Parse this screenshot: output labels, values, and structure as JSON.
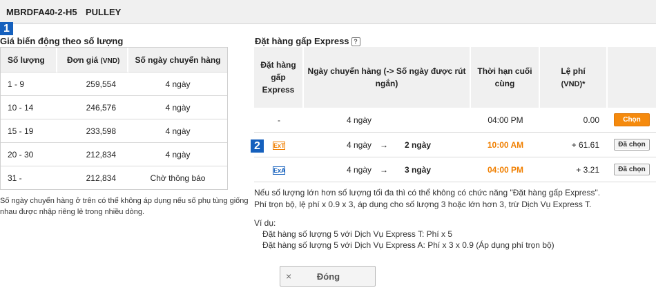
{
  "header": {
    "code": "MBRDFA40-2-H5",
    "name": "PULLEY"
  },
  "left": {
    "badge": "1",
    "title": "Giá biến động theo số lượng",
    "columns": {
      "qty": "Số lượng",
      "price": "Đơn giá",
      "price_unit": "(VND)",
      "days": "Số ngày chuyển hàng"
    },
    "rows": [
      {
        "qty": "1 - 9",
        "price": "259,554",
        "days": "4 ngày"
      },
      {
        "qty": "10 - 14",
        "price": "246,576",
        "days": "4 ngày"
      },
      {
        "qty": "15 - 19",
        "price": "233,598",
        "days": "4 ngày"
      },
      {
        "qty": "20 - 30",
        "price": "212,834",
        "days": "4 ngày"
      },
      {
        "qty": "31 -",
        "price": "212,834",
        "days": "Chờ thông báo"
      }
    ],
    "note": "Số ngày chuyển hàng ở trên có thể không áp dụng nếu số phụ tùng giống nhau được nhập riêng lẻ trong nhiều dòng."
  },
  "right": {
    "badge": "2",
    "title": "Đặt hàng gấp Express",
    "help_icon": "?",
    "columns": {
      "express": "Đặt hàng gấp Express",
      "shipping": "Ngày chuyển hàng (-> Số ngày được rút ngắn)",
      "deadline": "Thời hạn cuối cùng",
      "fee": "Lệ phí",
      "fee_unit": "(VND)*"
    },
    "rows": [
      {
        "type": "-",
        "days": "4 ngày",
        "arrow": "",
        "new_days": "",
        "deadline": "04:00 PM",
        "fee": "0.00",
        "button": "Chọn"
      },
      {
        "type": "ExT",
        "days": "4 ngày",
        "arrow": "→",
        "new_days": "2 ngày",
        "deadline": "10:00 AM",
        "fee": "+ 61.61",
        "button": "Đã chọn"
      },
      {
        "type": "ExA",
        "days": "4 ngày",
        "arrow": "→",
        "new_days": "3 ngày",
        "deadline": "04:00 PM",
        "fee": "+ 3.21",
        "button": "Đã chọn"
      }
    ],
    "note_line1": "Nếu số lượng lớn hơn số lượng tối đa thì có thể không có chức năng \"Đặt hàng gấp Express\".",
    "note_line2": "Phí trọn bộ, lệ phí x 0.9 x 3, áp dụng cho số lượng 3 hoặc lớn hơn 3, trừ Dịch Vụ Express T.",
    "example_label": "Ví dụ:",
    "example_line1": "Đặt hàng số lượng 5 với Dịch Vụ Express T: Phí x 5",
    "example_line2": "Đặt hàng số lượng 5 với Dịch Vụ Express A: Phí x 3 x 0.9 (Áp dụng phí trọn bộ)"
  },
  "footer": {
    "close_icon": "×",
    "close_label": "Đóng"
  },
  "colors": {
    "accent_blue": "#1560bd",
    "orange": "#f58a0d",
    "header_bg": "#f0f0f0"
  }
}
